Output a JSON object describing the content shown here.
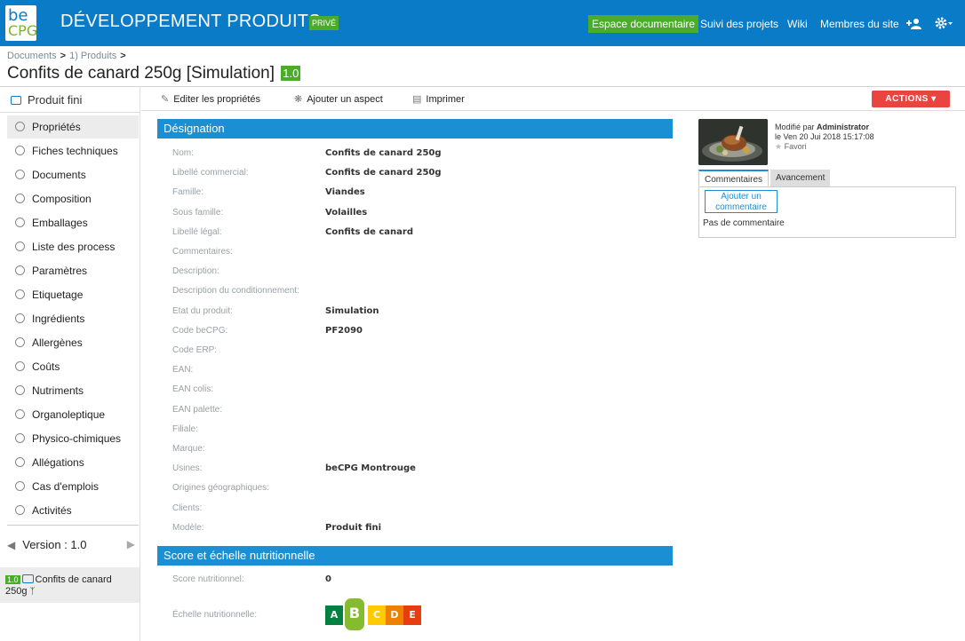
{
  "header": {
    "logo_top": "be",
    "logo_bottom": "CPG",
    "site_title": "DÉVELOPPEMENT PRODUITS",
    "visibility_badge": "PRIVÉ",
    "nav": [
      "Espace documentaire",
      "Suivi des projets",
      "Wiki",
      "Membres du site"
    ],
    "icons": [
      "add-user-icon",
      "gear-icon"
    ],
    "colors": {
      "bar": "#0a7bc7",
      "accent_green": "#4bac2b"
    }
  },
  "breadcrumb": [
    "Documents",
    "1) Produits"
  ],
  "page": {
    "title": "Confits de canard 250g [Simulation]",
    "version": "1.0"
  },
  "toolbar": {
    "edit": "Editer les propriétés",
    "aspect": "Ajouter un aspect",
    "print": "Imprimer",
    "actions": "ACTIONS ▾"
  },
  "sidebar": {
    "header": "Produit fini",
    "items": [
      "Propriétés",
      "Fiches techniques",
      "Documents",
      "Composition",
      "Emballages",
      "Liste des process",
      "Paramètres",
      "Etiquetage",
      "Ingrédients",
      "Allergènes",
      "Coûts",
      "Nutriments",
      "Organoleptique",
      "Physico-chimiques",
      "Allégations",
      "Cas d'emplois",
      "Activités"
    ],
    "active_index": 0,
    "version_label": "Version : 1.0",
    "version_item": {
      "badge": "1.0",
      "name": "Confits de canard 250g"
    }
  },
  "sections": {
    "designation": "Désignation",
    "nutrition": "Score et échelle nutritionnelle"
  },
  "properties": [
    {
      "label": "Nom:",
      "value": "Confits de canard 250g"
    },
    {
      "label": "Libellé commercial:",
      "value": "Confits de canard 250g"
    },
    {
      "label": "Famille:",
      "value": "Viandes"
    },
    {
      "label": "Sous famille:",
      "value": "Volailles"
    },
    {
      "label": "Libellé légal:",
      "value": "Confits de canard"
    },
    {
      "label": "Commentaires:",
      "value": ""
    },
    {
      "label": "Description:",
      "value": ""
    },
    {
      "label": "Description du conditionnement:",
      "value": ""
    },
    {
      "label": "Etat du produit:",
      "value": "Simulation"
    },
    {
      "label": "Code beCPG:",
      "value": "PF2090"
    },
    {
      "label": "Code ERP:",
      "value": ""
    },
    {
      "label": "EAN:",
      "value": ""
    },
    {
      "label": "EAN colis:",
      "value": ""
    },
    {
      "label": "EAN palette:",
      "value": ""
    },
    {
      "label": "Filiale:",
      "value": ""
    },
    {
      "label": "Marque:",
      "value": ""
    },
    {
      "label": "Usines:",
      "value": "beCPG Montrouge"
    },
    {
      "label": "Origines géographiques:",
      "value": ""
    },
    {
      "label": "Clients:",
      "value": ""
    },
    {
      "label": "Modèle:",
      "value": "Produit fini"
    }
  ],
  "nutrition": {
    "score_label": "Score nutritionnel:",
    "score_value": "0",
    "scale_label": "Échelle nutritionnelle:",
    "scale": [
      {
        "letter": "A",
        "color": "#038141"
      },
      {
        "letter": "B",
        "color": "#85bb2f"
      },
      {
        "letter": "C",
        "color": "#fecb02"
      },
      {
        "letter": "D",
        "color": "#ee8100"
      },
      {
        "letter": "E",
        "color": "#e63e11"
      }
    ],
    "selected": "B"
  },
  "right_panel": {
    "modified_prefix": "Modifié par",
    "modified_by": "Administrator",
    "modified_date": "le Ven 20 Jui 2018 15:17:08",
    "favorite": "Favori",
    "tabs": [
      "Commentaires",
      "Avancement"
    ],
    "add_comment": "Ajouter un commentaire",
    "no_comment": "Pas de commentaire"
  }
}
